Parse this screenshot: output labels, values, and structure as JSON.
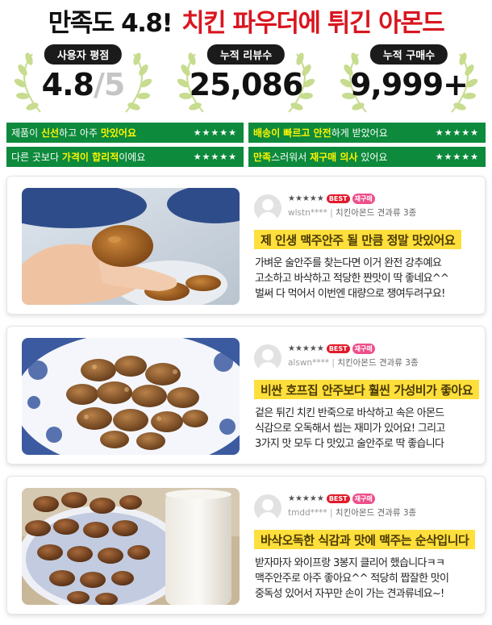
{
  "header": {
    "prefix": "만족도 4.8!",
    "highlight": "치킨 파우더에 튀긴 아몬드"
  },
  "stats": [
    {
      "label": "사용자 평점",
      "value": "4.8",
      "suffix": "/5"
    },
    {
      "label": "누적 리뷰수",
      "value": "25,086",
      "suffix": ""
    },
    {
      "label": "누적 구매수",
      "value": "9,999+",
      "suffix": ""
    }
  ],
  "summary_bars": [
    {
      "before": "제품이 ",
      "hl1": "신선",
      "mid": "하고 아주 ",
      "hl2": "맛있어요",
      "after": "",
      "stars": "★★★★★"
    },
    {
      "before": "",
      "hl1": "배송이 빠르고 안전",
      "mid": "하게 받았어요",
      "hl2": "",
      "after": "",
      "stars": "★★★★★"
    },
    {
      "before": "다른 곳보다 ",
      "hl1": "가격이 합리적",
      "mid": "이에요",
      "hl2": "",
      "after": "",
      "stars": "★★★★★"
    },
    {
      "before": "",
      "hl1": "만족",
      "mid": "스러워서 ",
      "hl2": "재구매 의사",
      "after": " 있어요",
      "stars": "★★★★★"
    }
  ],
  "reviews": [
    {
      "stars": "★★★★★",
      "badge_best": "BEST",
      "badge_reorder": "재구매",
      "user": "wlstn****",
      "separator": "|",
      "product": "치킨아몬드 견과류 3종",
      "headline": "제 인생 맥주안주 될 만큼 정말 맛있어요",
      "body": [
        "가벼운 술안주를 찾는다면 이거 완전 강추예요",
        "고소하고 바삭하고 적당한 짠맛이 딱 좋네요^^",
        "벌써 다 먹어서 이번엔 대량으로 쟁여두려구요!"
      ]
    },
    {
      "stars": "★★★★★",
      "badge_best": "BEST",
      "badge_reorder": "재구매",
      "user": "alswn****",
      "separator": "|",
      "product": "치킨아몬드 견과류 3종",
      "headline": "비싼 호프집 안주보다 훨씬 가성비가 좋아요",
      "body": [
        "겉은 튀긴 치킨 반죽으로 바삭하고 속은 아몬드",
        "식감으로 오독해서 씹는 재미가 있어요! 그리고",
        "3가지 맛 모두 다 맛있고 술안주로 딱 좋습니다"
      ]
    },
    {
      "stars": "★★★★★",
      "badge_best": "BEST",
      "badge_reorder": "재구매",
      "user": "tmdd****",
      "separator": "|",
      "product": "치킨아몬드 견과류 3종",
      "headline": "바삭오독한 식감과 맛에 맥주는 순삭입니다",
      "body": [
        "받자마자 와이프랑 3봉지 클리어 했습니다ㅋㅋ",
        "맥주안주로 아주 좋아요^^ 적당히 짭잘한 맛이",
        "중독성 있어서 자꾸만 손이 가는 견과류네요~!"
      ]
    }
  ],
  "colors": {
    "brand_red": "#d9161f",
    "bar_green": "#0d8a3c",
    "highlight_yellow": "#fff500",
    "headline_bg": "#ffdf3b"
  }
}
